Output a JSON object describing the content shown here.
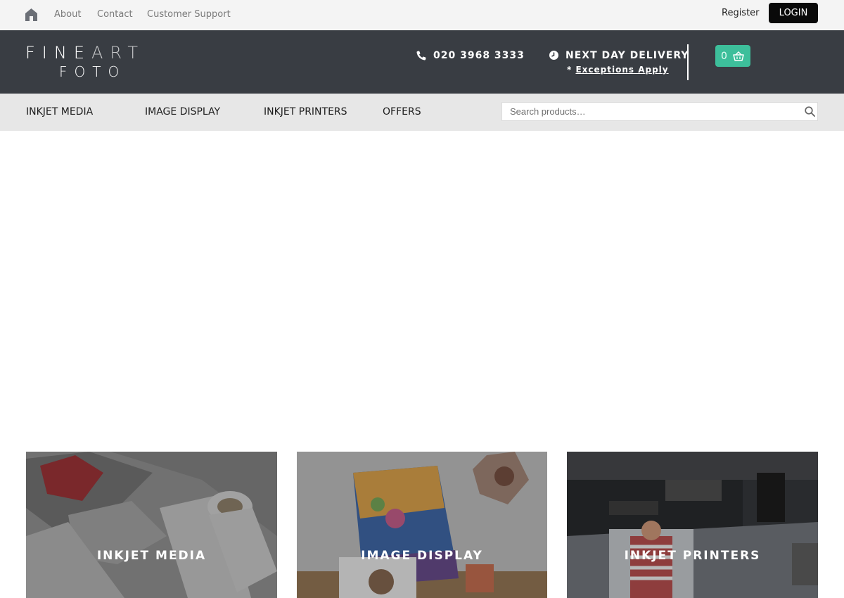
{
  "topbar": {
    "links": [
      "About",
      "Contact",
      "Customer Support"
    ],
    "register": "Register",
    "login": "LOGIN"
  },
  "header": {
    "logo_fine": "FINE",
    "logo_art": "ART",
    "logo_foto": "FOTO",
    "phone": "020 3968 3333",
    "delivery": "NEXT DAY DELIVERY",
    "exceptions_prefix": "* ",
    "exceptions_link": "Exceptions Apply",
    "cart_count": "0"
  },
  "nav": {
    "items": [
      "INKJET MEDIA",
      "IMAGE DISPLAY",
      "INKJET PRINTERS",
      "OFFERS"
    ],
    "search_placeholder": "Search products…"
  },
  "tiles": [
    {
      "label": "INKJET MEDIA"
    },
    {
      "label": "IMAGE DISPLAY"
    },
    {
      "label": "INKJET PRINTERS"
    }
  ],
  "colors": {
    "header_bg": "#393d43",
    "accent_green": "#3dbf9b",
    "nav_bg": "#e7e7e7"
  }
}
